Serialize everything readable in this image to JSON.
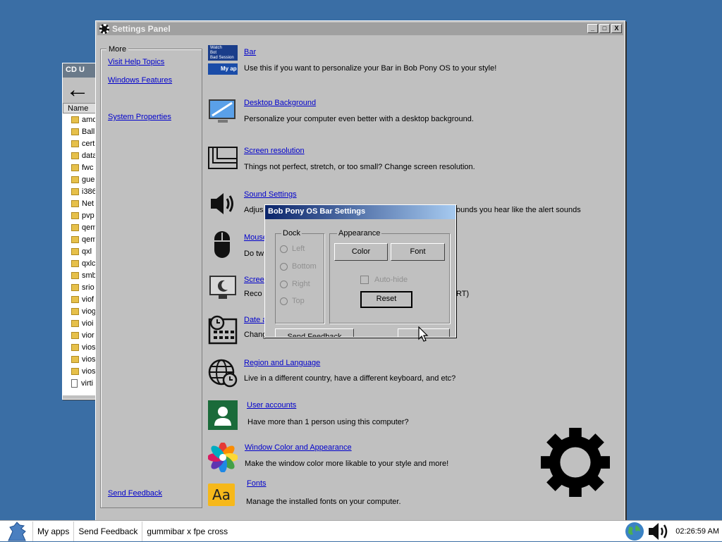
{
  "background_window": {
    "title": "CD U",
    "column_header": "Name",
    "files": [
      "amc",
      "Ball",
      "cert",
      "data",
      "fwc",
      "gue",
      "i386",
      "Net",
      "pvp",
      "qem",
      "qem",
      "qxl",
      "qxlc",
      "smb",
      "srio",
      "viof",
      "viog",
      "vioi",
      "vior",
      "vios",
      "vios",
      "vios",
      "virti"
    ]
  },
  "main_window": {
    "title": "Settings Panel",
    "buttons": {
      "minimize": "_",
      "maximize": "□",
      "close": "X"
    },
    "sidebar": {
      "legend": "More",
      "links": [
        "Visit Help Topics",
        "Windows Features",
        "System Properties"
      ],
      "send_feedback": "Send Feedback"
    },
    "items": [
      {
        "title": "Bar",
        "desc": "Use this if you want to personalize your Bar in Bob Pony OS to your style!",
        "icon": "bar-icon"
      },
      {
        "title": "Desktop Background",
        "desc": "Personalize your computer even better with a desktop background.",
        "icon": "desktop-background-icon"
      },
      {
        "title": "Screen resolution",
        "desc": "Things not perfect, stretch, or too small? Change screen resolution.",
        "icon": "screen-resolution-icon"
      },
      {
        "title": "Sound Settings",
        "desc": "Adjus",
        "desc_tail": "ounds you hear like the alert sounds",
        "icon": "speaker-icon"
      },
      {
        "title": "Mouse",
        "desc": "Do tw",
        "icon": "mouse-icon"
      },
      {
        "title": "Scree",
        "desc": "Reco",
        "desc_tail": "RT)",
        "icon": "screensaver-icon"
      },
      {
        "title": "Date a",
        "desc": "Chang",
        "icon": "calendar-clock-icon"
      },
      {
        "title": "Region and Language",
        "desc": "Live in a different country, have a different keyboard, and etc?",
        "icon": "globe-clock-icon"
      },
      {
        "title": "User accounts",
        "desc": "Have more than 1 person using this computer?",
        "icon": "user-icon"
      },
      {
        "title": "Window Color and Appearance",
        "desc": "Make the window color more likable to your style and more!",
        "icon": "color-wheel-icon"
      },
      {
        "title": "Fonts",
        "desc": "Manage the installed fonts on your computer.",
        "icon": "fonts-icon"
      }
    ],
    "bar_icon_labels": [
      "Watch",
      "Bot",
      "Bad Session",
      "My ap"
    ]
  },
  "dialog": {
    "title": "Bob Pony OS Bar Settings",
    "dock": {
      "legend": "Dock",
      "options": [
        "Left",
        "Bottom",
        "Right",
        "Top"
      ]
    },
    "appearance": {
      "legend": "Appearance",
      "color": "Color",
      "font": "Font",
      "autohide": "Auto-hide",
      "reset": "Reset"
    },
    "send_feedback": "Send Feedback"
  },
  "taskbar": {
    "items": [
      "My apps",
      "Send Feedback",
      "gummibar x fpe cross"
    ],
    "time": "02:26:59 AM"
  }
}
